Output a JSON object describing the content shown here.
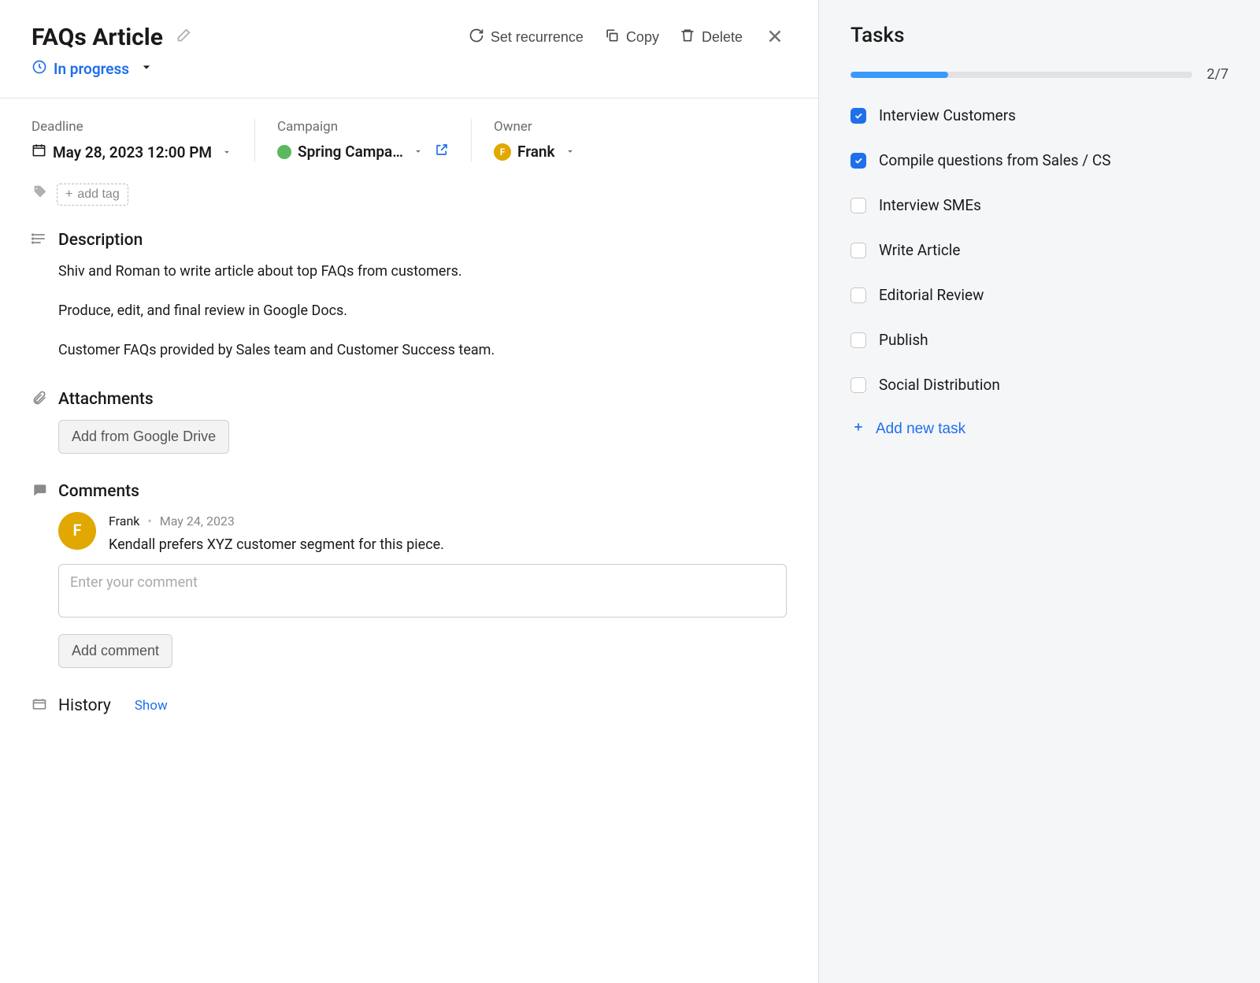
{
  "header": {
    "title": "FAQs Article",
    "set_recurrence": "Set recurrence",
    "copy": "Copy",
    "delete": "Delete"
  },
  "status": {
    "label": "In progress"
  },
  "meta": {
    "deadline_label": "Deadline",
    "deadline_value": "May 28, 2023 12:00 PM",
    "campaign_label": "Campaign",
    "campaign_value": "Spring Campa…",
    "owner_label": "Owner",
    "owner_value": "Frank",
    "owner_initial": "F"
  },
  "tags": {
    "add_label": "add tag"
  },
  "description": {
    "title": "Description",
    "p1": "Shiv and Roman to write article about top FAQs from customers.",
    "p2": "Produce, edit, and final review in Google Docs.",
    "p3": "Customer FAQs provided by Sales team and Customer Success team."
  },
  "attachments": {
    "title": "Attachments",
    "button": "Add from Google Drive"
  },
  "comments": {
    "title": "Comments",
    "author": "Frank",
    "author_initial": "F",
    "date": "May 24, 2023",
    "text": "Kendall prefers XYZ customer segment for this piece.",
    "placeholder": "Enter your comment",
    "add_button": "Add comment"
  },
  "history": {
    "title": "History",
    "show": "Show"
  },
  "tasks": {
    "title": "Tasks",
    "progress_text": "2/7",
    "progress_percent": 28.6,
    "items": [
      {
        "label": "Interview Customers",
        "checked": true
      },
      {
        "label": "Compile questions from Sales / CS",
        "checked": true
      },
      {
        "label": "Interview SMEs",
        "checked": false
      },
      {
        "label": "Write Article",
        "checked": false
      },
      {
        "label": "Editorial Review",
        "checked": false
      },
      {
        "label": "Publish",
        "checked": false
      },
      {
        "label": "Social Distribution",
        "checked": false
      }
    ],
    "add_label": "Add new task"
  }
}
